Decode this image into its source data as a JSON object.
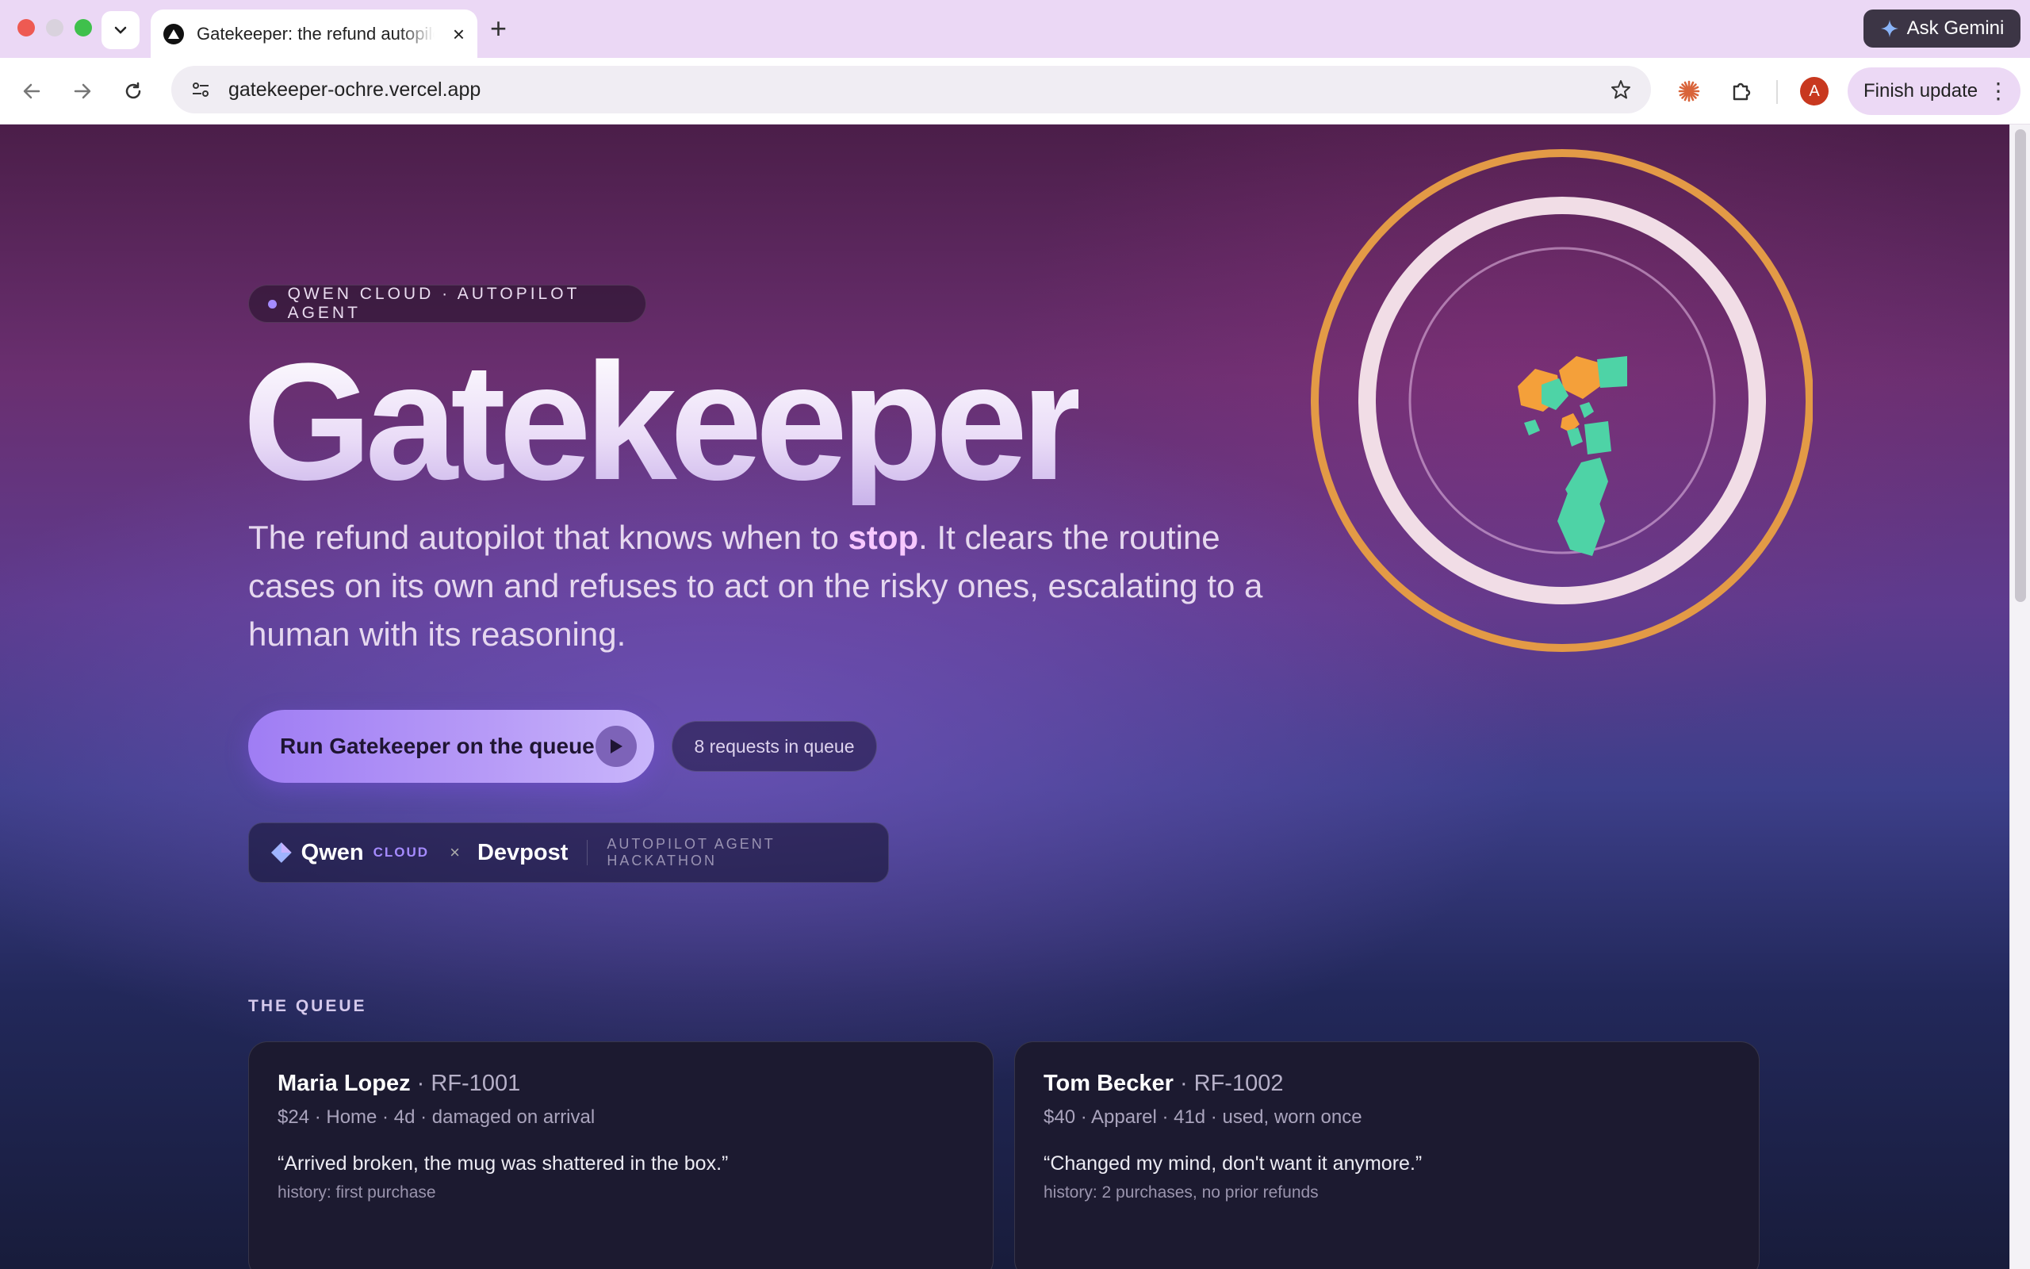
{
  "browser": {
    "tab_title": "Gatekeeper: the refund autopilot",
    "url": "gatekeeper-ochre.vercel.app",
    "ask_gemini": "Ask Gemini",
    "finish_update": "Finish update",
    "avatar_letter": "A",
    "new_tab_glyph": "+",
    "close_glyph": "×"
  },
  "hero": {
    "badge": "QWEN CLOUD · AUTOPILOT AGENT",
    "title": "Gatekeeper",
    "subtitle_before": "The refund autopilot that knows when to ",
    "subtitle_highlight": "stop",
    "subtitle_after": ". It clears the routine cases on its own and refuses to act on the risky ones, escalating to a human with its reasoning.",
    "run_button": "Run Gatekeeper on the queue",
    "queue_count": "8 requests in queue"
  },
  "partner": {
    "qwen": "Qwen",
    "cloud": "CLOUD",
    "x": "×",
    "devpost": "Devpost",
    "hackathon": "AUTOPILOT AGENT HACKATHON"
  },
  "queue": {
    "heading": "THE QUEUE",
    "cards": [
      {
        "name": "Maria Lopez",
        "id": "· RF-1001",
        "meta": "$24 · Home · 4d · damaged on arrival",
        "quote": "“Arrived broken, the mug was shattered in the box.”",
        "history": "history: first purchase"
      },
      {
        "name": "Tom Becker",
        "id": "· RF-1002",
        "meta": "$40 · Apparel · 41d · used, worn once",
        "quote": "“Changed my mind, don't want it anymore.”",
        "history": "history: 2 purchases, no prior refunds"
      }
    ]
  },
  "colors": {
    "accent": "#a58bff",
    "ring_outer": "#e39a46",
    "ring_inner": "#f1dde6",
    "shape_orange": "#f4a03a",
    "shape_teal": "#4ed3a6"
  },
  "icons": [
    "back-arrow-icon",
    "forward-arrow-icon",
    "reload-icon",
    "site-info-icon",
    "bookmark-star-icon",
    "extension-puzzle-icon",
    "play-icon",
    "qwen-logo-icon"
  ]
}
